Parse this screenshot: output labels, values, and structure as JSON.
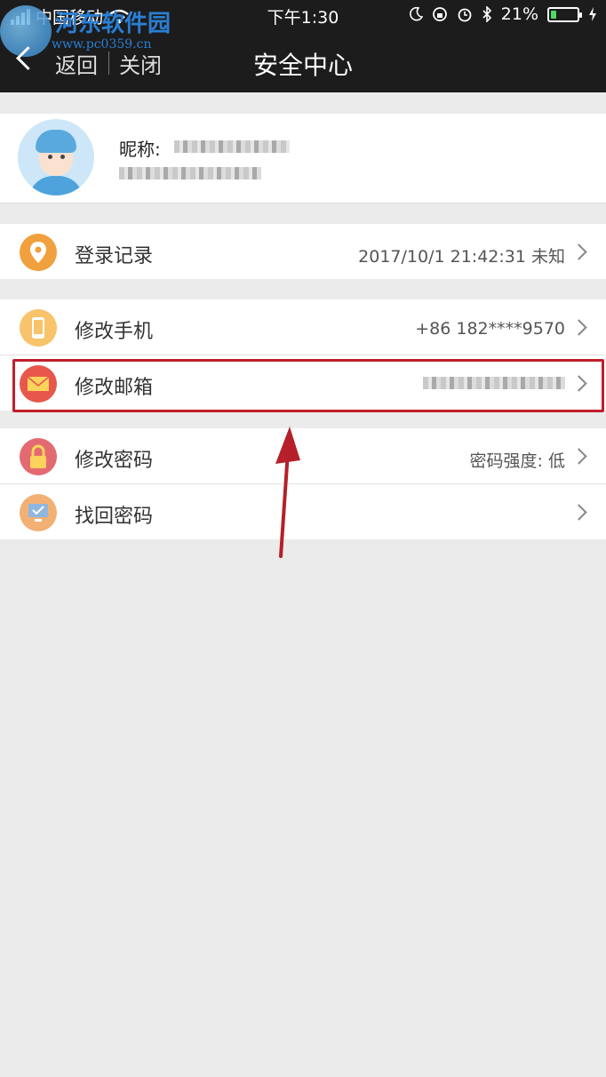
{
  "status": {
    "carrier": "中国移动",
    "time": "下午1:30",
    "battery_text": "21%",
    "battery_level": 0.21
  },
  "watermark": {
    "name": "河东软件园",
    "url": "www.pc0359.cn"
  },
  "nav": {
    "back_label": "返回",
    "close_label": "关闭",
    "title": "安全中心"
  },
  "profile": {
    "nickname_label": "昵称:"
  },
  "rows": {
    "login_record": {
      "label": "登录记录",
      "value": "2017/10/1 21:42:31 未知"
    },
    "change_phone": {
      "label": "修改手机",
      "value": "+86 182****9570"
    },
    "change_email": {
      "label": "修改邮箱"
    },
    "change_password": {
      "label": "修改密码",
      "value": "密码强度: 低"
    },
    "recover_password": {
      "label": "找回密码"
    }
  },
  "colors": {
    "nav_bg": "#1c1c1c",
    "highlight": "#c01f2a",
    "login_icon": "#f0a03c",
    "phone_icon": "#f7c36b",
    "email_icon": "#e8574b",
    "lock_icon": "#e46a72",
    "recover_icon": "#f2b074"
  },
  "icons": {
    "login_record": "location-pin-icon",
    "change_phone": "phone-icon",
    "change_email": "envelope-icon",
    "change_password": "lock-icon",
    "recover_password": "monitor-icon"
  }
}
